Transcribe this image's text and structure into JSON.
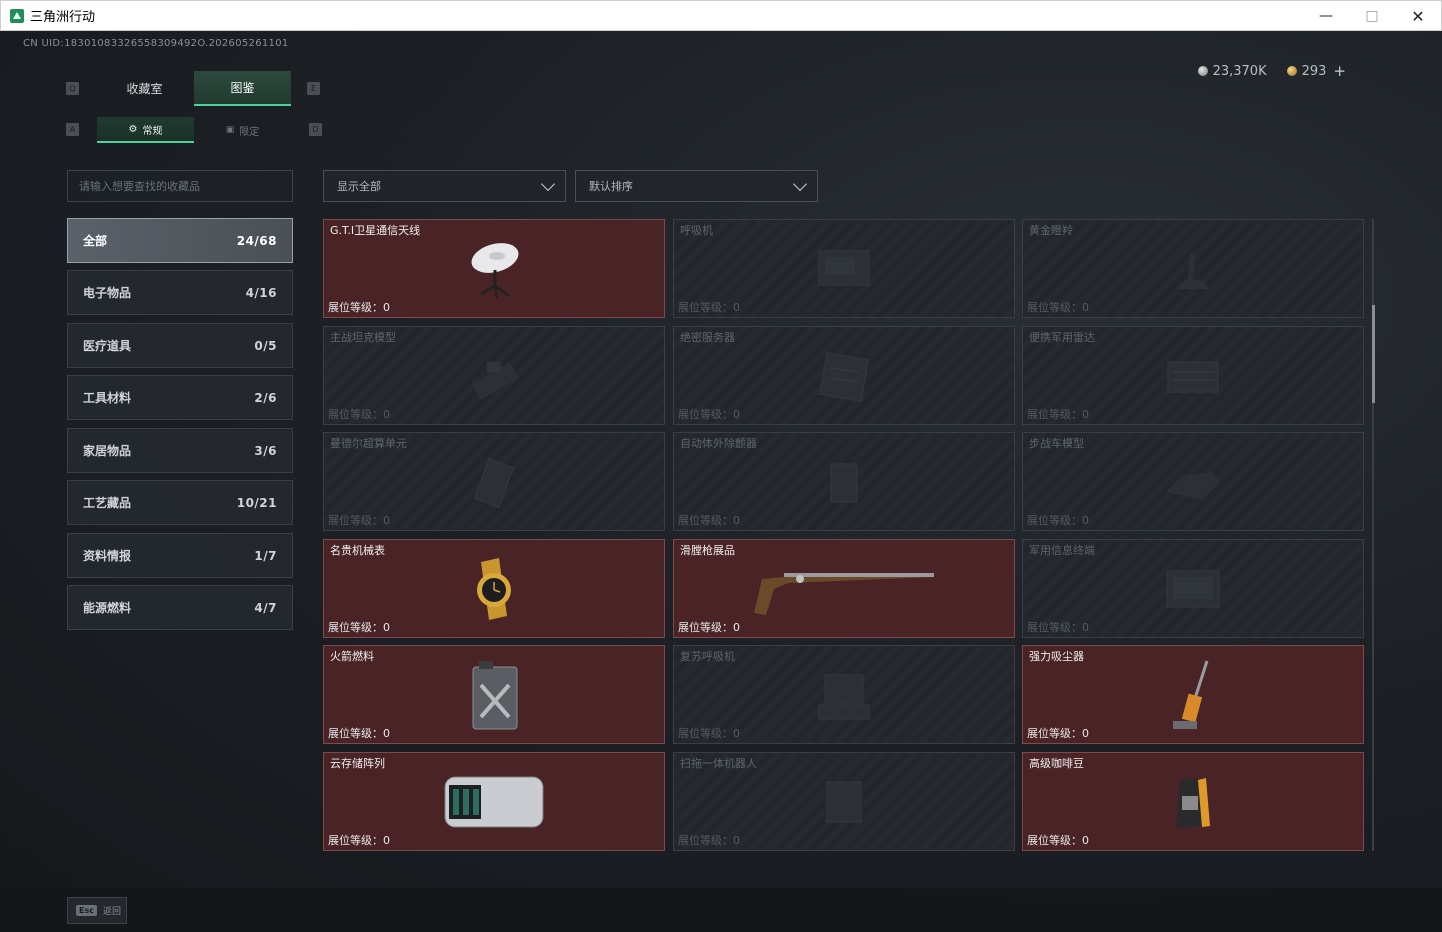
{
  "window": {
    "title": "三角洲行动"
  },
  "header": {
    "uid": "CN UID:18301083326558309492O.202605261101",
    "currency": [
      {
        "icon": "silver-coin-icon",
        "value": "23,370K"
      },
      {
        "icon": "gold-coin-icon",
        "value": "293"
      }
    ],
    "plus_label": "+"
  },
  "tabs": {
    "main": [
      {
        "label": "收藏室",
        "key": "Q",
        "active": false
      },
      {
        "label": "图鉴",
        "key": "E",
        "active": true
      }
    ],
    "sub": [
      {
        "label": "常规",
        "key": "A",
        "active": true
      },
      {
        "label": "限定",
        "key": "D",
        "active": false
      }
    ]
  },
  "search": {
    "placeholder": "请输入想要查找的收藏品"
  },
  "filters": {
    "show": "显示全部",
    "sort": "默认排序"
  },
  "categories": [
    {
      "label": "全部",
      "count": "24/68",
      "active": true
    },
    {
      "label": "电子物品",
      "count": "4/16"
    },
    {
      "label": "医疗道具",
      "count": "0/5"
    },
    {
      "label": "工具材料",
      "count": "2/6"
    },
    {
      "label": "家居物品",
      "count": "3/6"
    },
    {
      "label": "工艺藏品",
      "count": "10/21"
    },
    {
      "label": "资料情报",
      "count": "1/7"
    },
    {
      "label": "能源燃料",
      "count": "4/7"
    }
  ],
  "items": [
    {
      "name": "G.T.I卫星通信天线",
      "level": "展位等级：0",
      "owned": true,
      "icon": "satellite-dish-icon"
    },
    {
      "name": "呼吸机",
      "level": "展位等级：0",
      "owned": false,
      "icon": "ventilator-icon"
    },
    {
      "name": "黄金瞪羚",
      "level": "展位等级：0",
      "owned": false,
      "icon": "gold-gazelle-icon"
    },
    {
      "name": "主战坦克模型",
      "level": "展位等级：0",
      "owned": false,
      "icon": "tank-model-icon"
    },
    {
      "name": "绝密服务器",
      "level": "展位等级：0",
      "owned": false,
      "icon": "server-icon"
    },
    {
      "name": "便携军用雷达",
      "level": "展位等级：0",
      "owned": false,
      "icon": "radar-icon"
    },
    {
      "name": "曼德尔超算单元",
      "level": "展位等级：0",
      "owned": false,
      "icon": "compute-unit-icon"
    },
    {
      "name": "自动体外除颤器",
      "level": "展位等级：0",
      "owned": false,
      "icon": "defibrillator-icon"
    },
    {
      "name": "步战车模型",
      "level": "展位等级：0",
      "owned": false,
      "icon": "ifv-model-icon"
    },
    {
      "name": "名贵机械表",
      "level": "展位等级：0",
      "owned": true,
      "icon": "gold-watch-icon"
    },
    {
      "name": "滑膛枪展品",
      "level": "展位等级：0",
      "owned": true,
      "icon": "musket-icon"
    },
    {
      "name": "军用信息终端",
      "level": "展位等级：0",
      "owned": false,
      "icon": "military-terminal-icon"
    },
    {
      "name": "火箭燃料",
      "level": "展位等级：0",
      "owned": true,
      "icon": "fuel-canister-icon"
    },
    {
      "name": "复苏呼吸机",
      "level": "展位等级：0",
      "owned": false,
      "icon": "resus-ventilator-icon"
    },
    {
      "name": "强力吸尘器",
      "level": "展位等级：0",
      "owned": true,
      "icon": "vacuum-cleaner-icon"
    },
    {
      "name": "云存储阵列",
      "level": "展位等级：0",
      "owned": true,
      "icon": "storage-array-icon"
    },
    {
      "name": "扫拖一体机器人",
      "level": "展位等级：0",
      "owned": false,
      "icon": "robot-vacuum-icon"
    },
    {
      "name": "高级咖啡豆",
      "level": "展位等级：0",
      "owned": true,
      "icon": "coffee-bag-icon"
    }
  ],
  "footer": {
    "key": "Esc",
    "label": "返回"
  },
  "colors": {
    "accent": "#4fd29a",
    "owned_card": "#4a2327"
  }
}
